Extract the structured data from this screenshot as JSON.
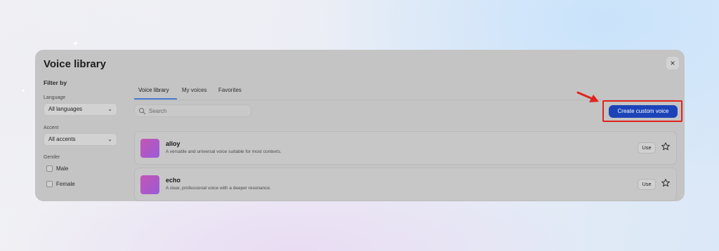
{
  "dialog": {
    "title": "Voice library",
    "close_glyph": "×"
  },
  "sidebar": {
    "filter_title": "Filter by",
    "language": {
      "label": "Language",
      "value": "All languages"
    },
    "accent": {
      "label": "Accent",
      "value": "All accents"
    },
    "gender": {
      "label": "Gender",
      "options": [
        {
          "label": "Male",
          "checked": false
        },
        {
          "label": "Female",
          "checked": false
        }
      ]
    }
  },
  "tabs": [
    {
      "label": "Voice library",
      "active": true
    },
    {
      "label": "My voices",
      "active": false
    },
    {
      "label": "Favorites",
      "active": false
    }
  ],
  "search": {
    "placeholder": "Search"
  },
  "create_button": {
    "label": "Create custom voice",
    "color": "#1c43b8"
  },
  "voices": [
    {
      "name": "alloy",
      "description": "A versatile and universal voice suitable for most contexts.",
      "use_label": "Use",
      "icon": "star-icon"
    },
    {
      "name": "echo",
      "description": "A clear, professional voice with a deeper resonance.",
      "use_label": "Use",
      "icon": "star-icon"
    }
  ],
  "annotation": {
    "highlight_color": "#e0231e",
    "arrow_color": "#e0231e"
  }
}
